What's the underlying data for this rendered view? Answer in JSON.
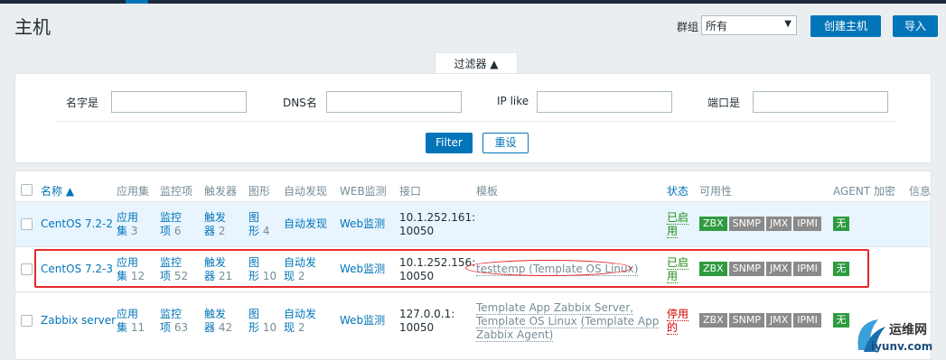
{
  "page": {
    "title": "主机"
  },
  "header": {
    "group_label": "群组",
    "group_value": "所有",
    "create_host_label": "创建主机",
    "import_label": "导入"
  },
  "filter": {
    "tab_label": "过滤器 ▲",
    "name_label": "名字是",
    "dns_label": "DNS名",
    "ip_label": "IP like",
    "port_label": "端口是",
    "filter_button": "Filter",
    "reset_button": "重设"
  },
  "table": {
    "headers": {
      "name": "名称 ▲",
      "applications": "应用集",
      "items": "监控项",
      "triggers": "触发器",
      "graphs": "图形",
      "discovery": "自动发现",
      "web": "WEB监测",
      "interface": "接口",
      "templates": "模板",
      "status": "状态",
      "availability": "可用性",
      "agent_encryption": "AGENT 加密",
      "info": "信息"
    },
    "rows": [
      {
        "name": "CentOS 7.2-2",
        "app_a": "应用",
        "app_b": "集",
        "app_count": "3",
        "item_a": "监控",
        "item_b": "项",
        "item_count": "6",
        "trig_a": "触发",
        "trig_b": "器",
        "trig_count": "2",
        "graph_a": "图",
        "graph_b": "形",
        "graph_count": "4",
        "discovery": "自动发现",
        "web": "Web监测",
        "iface_a": "10.1.252.161:",
        "iface_b": "10050",
        "status_a": "已启",
        "status_b": "用",
        "avail": [
          "ZBX",
          "SNMP",
          "JMX",
          "IPMI"
        ],
        "encryption": "无"
      },
      {
        "name": "CentOS 7.2-3",
        "app_a": "应用",
        "app_b": "集",
        "app_count": "12",
        "item_a": "监控",
        "item_b": "项",
        "item_count": "52",
        "trig_a": "触发",
        "trig_b": "器",
        "trig_count": "21",
        "graph_a": "图",
        "graph_b": "形",
        "graph_count": "10",
        "disc_a": "自动发",
        "disc_b": "现",
        "disc_count": "2",
        "web": "Web监测",
        "iface_a": "10.1.252.156:",
        "iface_b": "10050",
        "template_1": "testtemp",
        "template_1_paren": "(Template OS Linux)",
        "status_a": "已启",
        "status_b": "用",
        "avail": [
          "ZBX",
          "SNMP",
          "JMX",
          "IPMI"
        ],
        "encryption": "无"
      },
      {
        "name": "Zabbix server",
        "app_a": "应用",
        "app_b": "集",
        "app_count": "11",
        "item_a": "监控",
        "item_b": "项",
        "item_count": "63",
        "trig_a": "触发",
        "trig_b": "器",
        "trig_count": "42",
        "graph_a": "图",
        "graph_b": "形",
        "graph_count": "10",
        "disc_a": "自动发",
        "disc_b": "现",
        "disc_count": "2",
        "web": "Web监测",
        "iface_a": "127.0.0.1:",
        "iface_b": "10050",
        "tpl_line1": "Template App Zabbix Server,",
        "tpl_line2a": "Template OS Linux",
        "tpl_line2b": "(Template App",
        "tpl_line3": "Zabbix Agent)",
        "status_a": "停用",
        "status_b": "的",
        "avail": [
          "ZBX",
          "SNMP",
          "JMX",
          "IPMI"
        ],
        "encryption": "无"
      }
    ]
  },
  "watermark": {
    "line1": "运维网",
    "line2": "iyunv.com"
  },
  "colors": {
    "accent": "#0275b8",
    "enabled": "#1f8a17",
    "disabled": "#d40000",
    "available": "#2f9b40",
    "unknown": "#8a8a8a",
    "highlight": "#e3292c"
  }
}
